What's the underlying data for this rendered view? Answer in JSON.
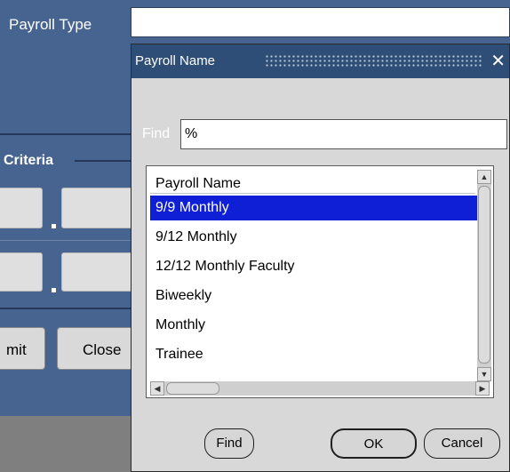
{
  "background_form": {
    "payroll_type_label": "Payroll Type",
    "payroll_type_value": "",
    "criteria_label": "Criteria",
    "submit_button_partial": "mit",
    "close_button_partial": "Close"
  },
  "dialog": {
    "title": "Payroll Name",
    "close_icon": "close-icon",
    "find_label": "Find",
    "find_value": "%",
    "list": {
      "header": "Payroll Name",
      "rows": [
        {
          "label": "9/9 Monthly",
          "selected": true
        },
        {
          "label": "9/12 Monthly",
          "selected": false
        },
        {
          "label": "12/12 Monthly Faculty",
          "selected": false
        },
        {
          "label": "Biweekly",
          "selected": false
        },
        {
          "label": "Monthly",
          "selected": false
        },
        {
          "label": "Trainee",
          "selected": false
        }
      ]
    },
    "buttons": {
      "find": "Find",
      "ok": "OK",
      "cancel": "Cancel"
    }
  },
  "colors": {
    "form_background": "#46648f",
    "title_bar": "#2f4e77",
    "selection": "#0e1fd6",
    "dialog_background": "#d8d8d8"
  }
}
